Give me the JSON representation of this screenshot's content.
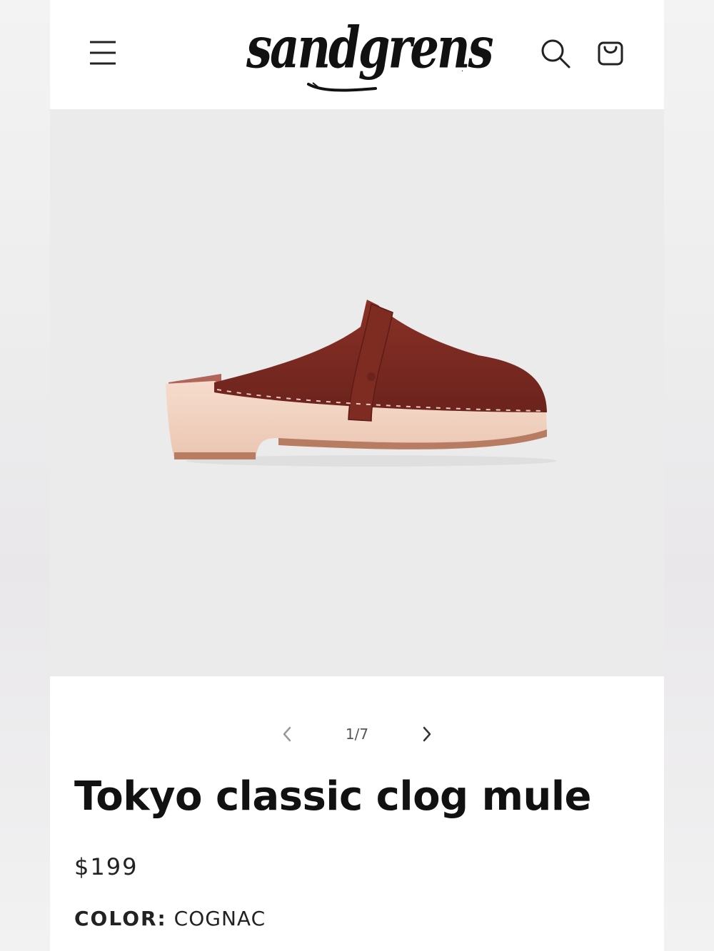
{
  "brand": {
    "logo_text": "sandgrens",
    "logo_reg": "."
  },
  "icons": {
    "menu": "hamburger-menu-icon",
    "search": "search-icon",
    "cart": "shopping-bag-icon",
    "prev": "chevron-left-icon",
    "next": "chevron-right-icon"
  },
  "gallery": {
    "image_alt": "Tokyo classic clog mule",
    "counter": "1/7"
  },
  "product": {
    "title": "Tokyo classic clog mule",
    "price": "$199",
    "color_label": "COLOR:",
    "color_value": "COGNAC"
  },
  "colors": {
    "leather": "#7a2a22",
    "wood": "#f2d2c2",
    "sole": "#b77c62",
    "gallery_bg": "#ebebeb"
  }
}
